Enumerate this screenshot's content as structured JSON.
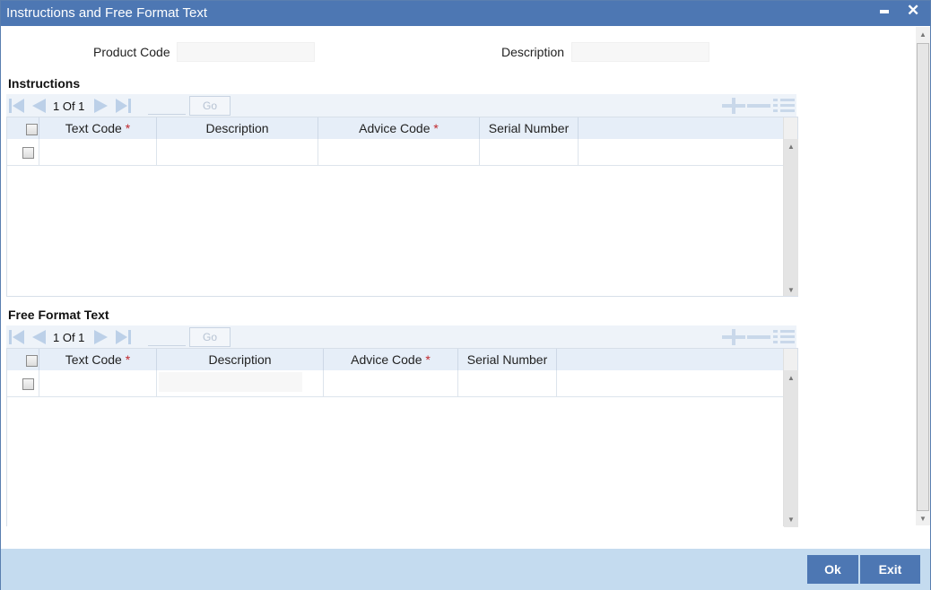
{
  "window": {
    "title": "Instructions and Free Format Text"
  },
  "header": {
    "product_code_label": "Product Code",
    "product_code_value": "",
    "description_label": "Description",
    "description_value": ""
  },
  "instructions": {
    "title": "Instructions",
    "page_info": "1 Of 1",
    "go_label": "Go",
    "columns": [
      "Text Code",
      "Description",
      "Advice Code",
      "Serial Number"
    ],
    "required_marker": "*",
    "rows": [
      {
        "text_code": "",
        "description": "",
        "advice_code": "",
        "serial_number": ""
      }
    ]
  },
  "free_format": {
    "title": "Free Format Text",
    "page_info": "1 Of 1",
    "go_label": "Go",
    "columns": [
      "Text Code",
      "Description",
      "Advice Code",
      "Serial Number"
    ],
    "required_marker": "*",
    "rows": [
      {
        "text_code": "",
        "description": "",
        "advice_code": "",
        "serial_number": ""
      }
    ]
  },
  "footer": {
    "ok_label": "Ok",
    "exit_label": "Exit"
  },
  "colors": {
    "title_bar": "#4d77b3",
    "footer": "#c4dbef",
    "button": "#4d77b3",
    "required": "#c0282d"
  },
  "icons": [
    "first-page-icon",
    "prev-page-icon",
    "next-page-icon",
    "last-page-icon",
    "add-row-icon",
    "delete-row-icon",
    "single-view-icon",
    "minimize-icon",
    "close-icon"
  ]
}
